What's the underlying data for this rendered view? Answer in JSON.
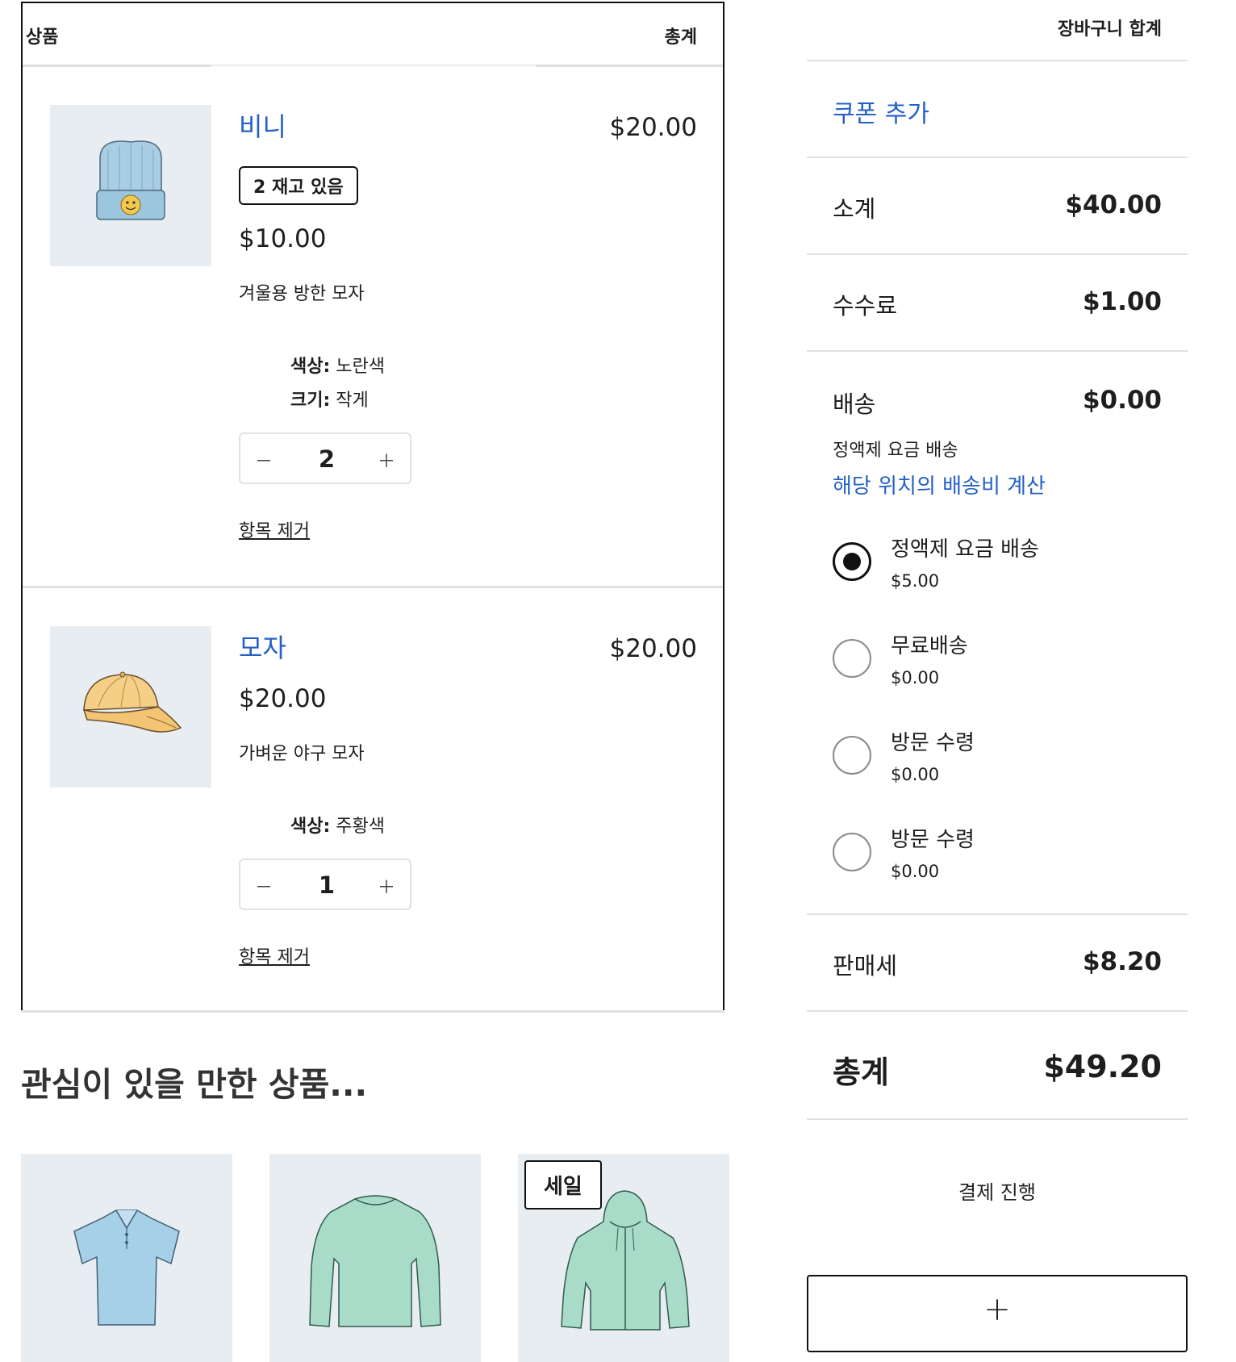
{
  "cart_table": {
    "header_product": "상품",
    "header_total": "총계"
  },
  "items": [
    {
      "name": "비니",
      "stock_badge": "2 재고 있음",
      "price": "$10.00",
      "description": "겨울용 방한 모자",
      "attributes": [
        {
          "label": "색상:",
          "value": "노란색"
        },
        {
          "label": "크기:",
          "value": "작게"
        }
      ],
      "quantity": "2",
      "minus": "－",
      "plus": "＋",
      "line_total": "$20.00",
      "remove_label": "항목 제거",
      "image_icon": "beanie-icon"
    },
    {
      "name": "모자",
      "price": "$20.00",
      "description": "가벼운 야구 모자",
      "attributes": [
        {
          "label": "색상:",
          "value": "주황색"
        }
      ],
      "quantity": "1",
      "minus": "－",
      "plus": "＋",
      "line_total": "$20.00",
      "remove_label": "항목 제거",
      "image_icon": "cap-icon"
    }
  ],
  "cross_sells": {
    "title": "관심이 있을 만한 상품...",
    "products": [
      {
        "icon": "polo-shirt-icon"
      },
      {
        "icon": "long-sleeve-shirt-icon"
      },
      {
        "icon": "hoodie-icon",
        "badge": "세일"
      }
    ]
  },
  "totals": {
    "title": "장바구니 합계",
    "coupon_label": "쿠폰 추가",
    "subtotal_label": "소계",
    "subtotal_value": "$40.00",
    "fee_label": "수수료",
    "fee_value": "$1.00",
    "shipping_label": "배송",
    "shipping_value": "$0.00",
    "shipping_method": "정액제 요금 배송",
    "shipping_calc_link": "해당 위치의 배송비 계산",
    "shipping_rates": [
      {
        "name": "정액제 요금 배송",
        "price": "$5.00",
        "selected": true
      },
      {
        "name": "무료배송",
        "price": "$0.00",
        "selected": false
      },
      {
        "name": "방문 수령",
        "price": "$0.00",
        "selected": false
      },
      {
        "name": "방문 수령",
        "price": "$0.00",
        "selected": false
      }
    ],
    "tax_label": "판매세",
    "tax_value": "$8.20",
    "grand_label": "총계",
    "grand_value": "$49.20",
    "checkout_label": "결제 진행",
    "add_button_label": "+"
  },
  "colors": {
    "link": "#2560c7",
    "thumb_bg": "#e8edf2",
    "border": "#111111",
    "separator": "#e0e0e0"
  }
}
